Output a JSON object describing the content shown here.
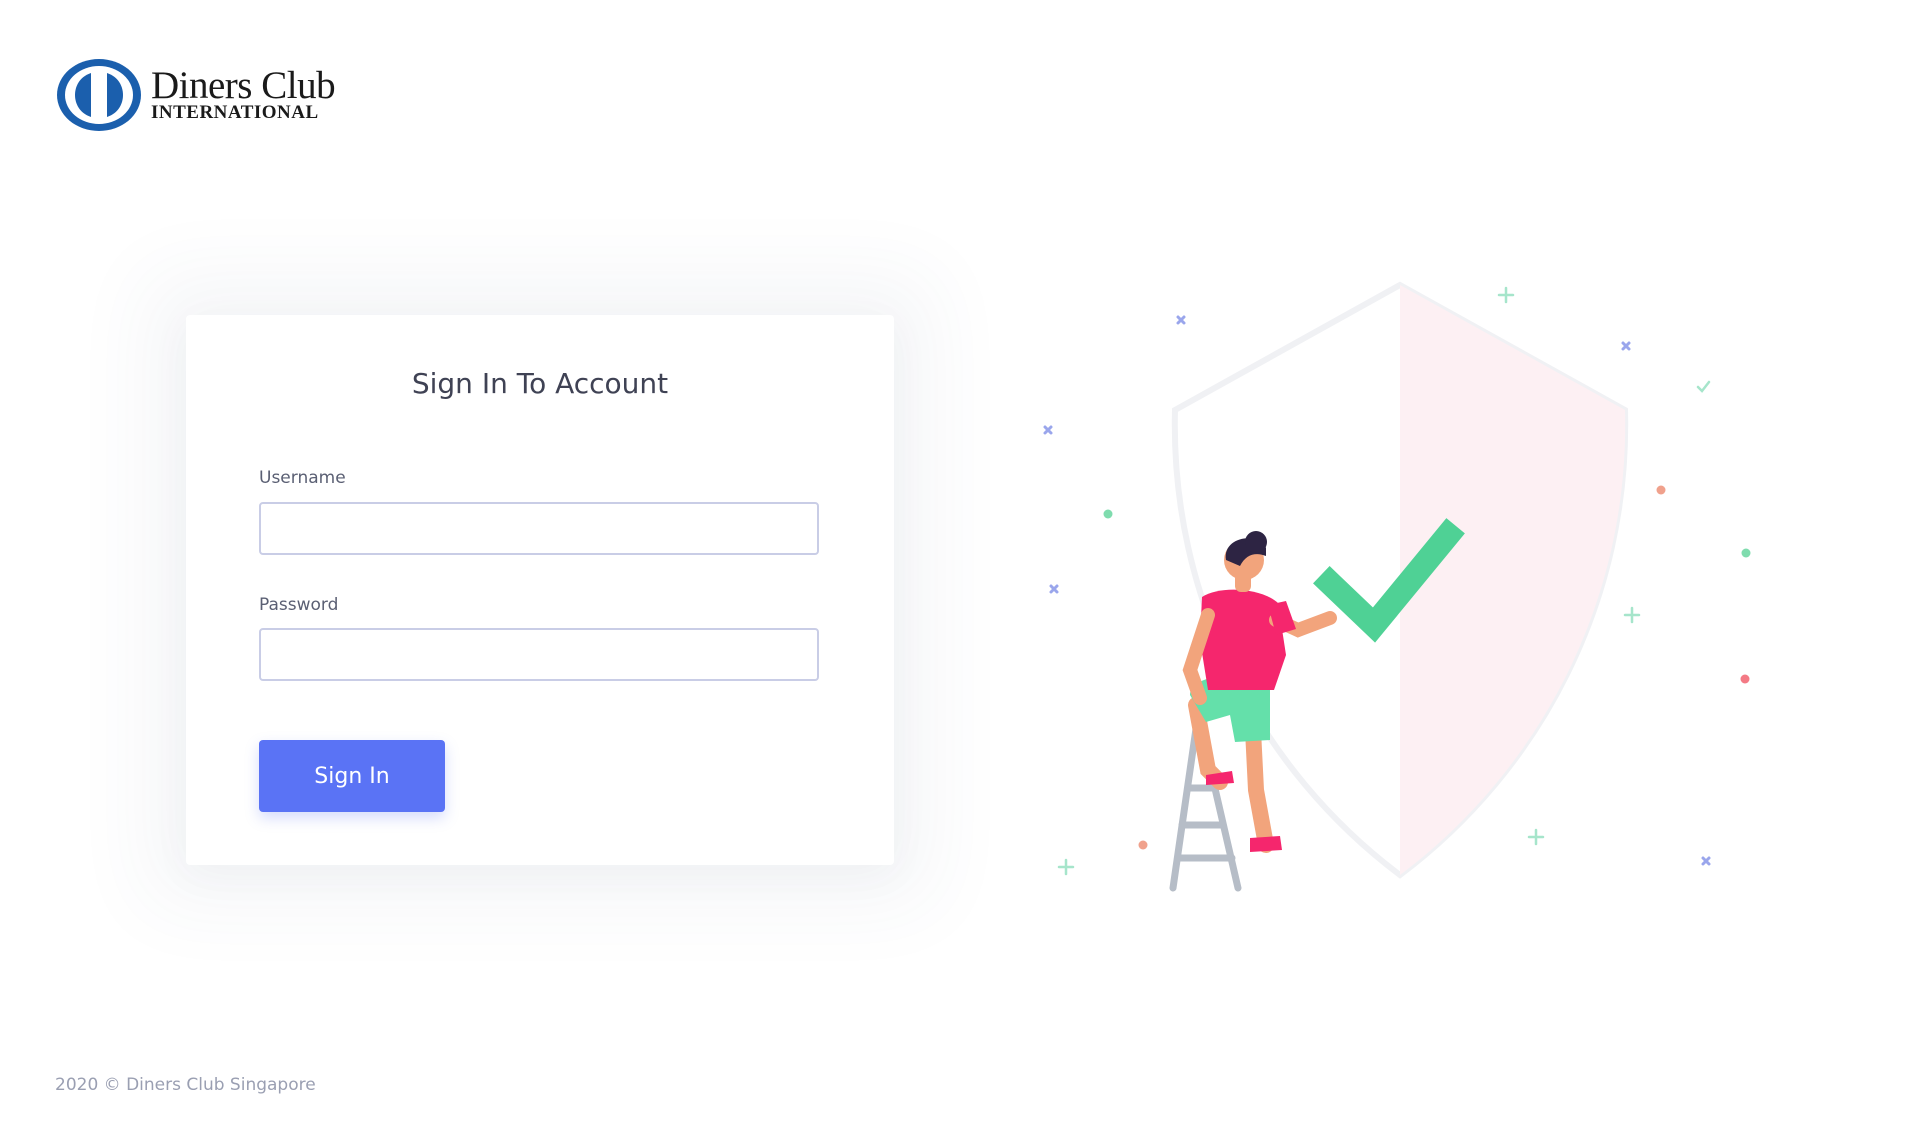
{
  "brand": {
    "name_line1": "Diners Club",
    "name_line2": "INTERNATIONAL",
    "logo_color": "#1b5fad",
    "logo_icon": "diners-club-logo-icon"
  },
  "login_card": {
    "title": "Sign In To Account",
    "username_label": "Username",
    "username_value": "",
    "password_label": "Password",
    "password_value": "",
    "signin_label": "Sign In"
  },
  "illustration": {
    "description_icon": "security-shield-illustration",
    "accent_color": "#4fd195",
    "shirt_color": "#f5266d",
    "button_color": "#5a73f5"
  },
  "footer": {
    "copyright": "2020 © Diners Club Singapore"
  }
}
